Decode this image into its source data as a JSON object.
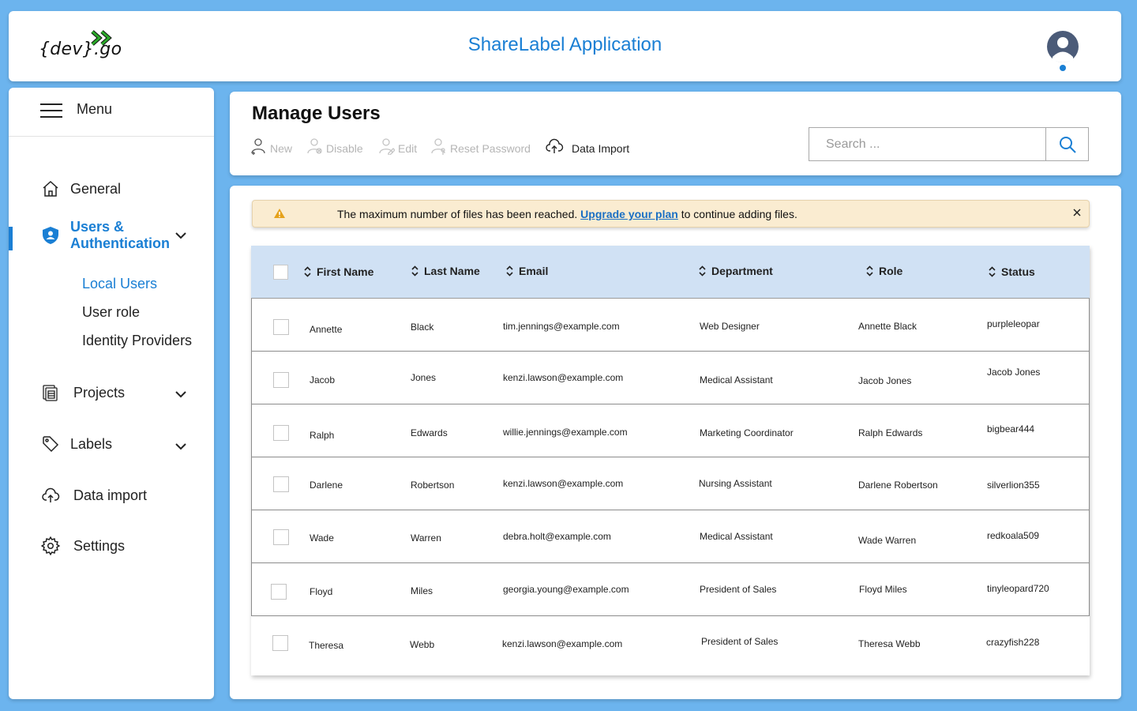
{
  "header": {
    "logo_text": "{dev}.go",
    "app_title": "ShareLabel Application",
    "colors": {
      "accent": "#1a7fd4",
      "logo_arrow": "#2aa829",
      "background": "#6cb4ee"
    }
  },
  "sidebar": {
    "menu_label": "Menu",
    "items": [
      {
        "label": "General",
        "icon": "home-icon"
      },
      {
        "label": "Users & Authentication",
        "icon": "shield-user-icon",
        "expanded": true
      },
      {
        "label": "Projects",
        "icon": "projects-icon"
      },
      {
        "label": "Labels",
        "icon": "tag-icon"
      },
      {
        "label": "Data import",
        "icon": "cloud-upload-icon"
      },
      {
        "label": "Settings",
        "icon": "gear-icon"
      }
    ],
    "users_auth_line1": "Users &",
    "users_auth_line2": "Authentication",
    "sub_items": [
      {
        "label": "Local Users",
        "active": true
      },
      {
        "label": "User role"
      },
      {
        "label": "Identity Providers"
      }
    ]
  },
  "toolbar": {
    "title": "Manage Users",
    "buttons": [
      {
        "label": "New",
        "icon": "user-add-icon",
        "enabled": false
      },
      {
        "label": "Disable",
        "icon": "user-disable-icon",
        "enabled": false
      },
      {
        "label": "Edit",
        "icon": "user-edit-icon",
        "enabled": false
      },
      {
        "label": "Reset Password",
        "icon": "user-key-icon",
        "enabled": false
      },
      {
        "label": "Data Import",
        "icon": "cloud-upload-icon",
        "enabled": true
      }
    ],
    "search_placeholder": "Search ..."
  },
  "alert": {
    "text_before": "The maximum number of files has been reached. ",
    "link_text": "Upgrade your plan",
    "text_after": " to continue adding files.",
    "icon": "warning-icon",
    "color": "#faecd1"
  },
  "table": {
    "columns": [
      "First Name",
      "Last Name",
      "Email",
      "Department",
      "Role",
      "Status"
    ],
    "rows": [
      {
        "first": "Annette",
        "last": "Black",
        "email": "tim.jennings@example.com",
        "department": "Web Designer",
        "role": "Annette Black",
        "status": "purpleleopar"
      },
      {
        "first": "Jacob",
        "last": "Jones",
        "email": "kenzi.lawson@example.com",
        "department": "Medical Assistant",
        "role": "Jacob Jones",
        "status": "Jacob Jones"
      },
      {
        "first": "Ralph",
        "last": "Edwards",
        "email": "willie.jennings@example.com",
        "department": "Marketing Coordinator",
        "role": "Ralph Edwards",
        "status": "bigbear444"
      },
      {
        "first": "Darlene",
        "last": "Robertson",
        "email": "kenzi.lawson@example.com",
        "department": "Nursing Assistant",
        "role": "Darlene Robertson",
        "status": "silverlion355"
      },
      {
        "first": "Wade",
        "last": "Warren",
        "email": "debra.holt@example.com",
        "department": "Medical Assistant",
        "role": "Wade Warren",
        "status": "redkoala509"
      },
      {
        "first": "Floyd",
        "last": "Miles",
        "email": "georgia.young@example.com",
        "department": "President of Sales",
        "role": "Floyd Miles",
        "status": "tinyleopard720"
      },
      {
        "first": "Theresa",
        "last": "Webb",
        "email": "kenzi.lawson@example.com",
        "department": "President of Sales",
        "role": "Theresa Webb",
        "status": "crazyfish228"
      }
    ]
  }
}
